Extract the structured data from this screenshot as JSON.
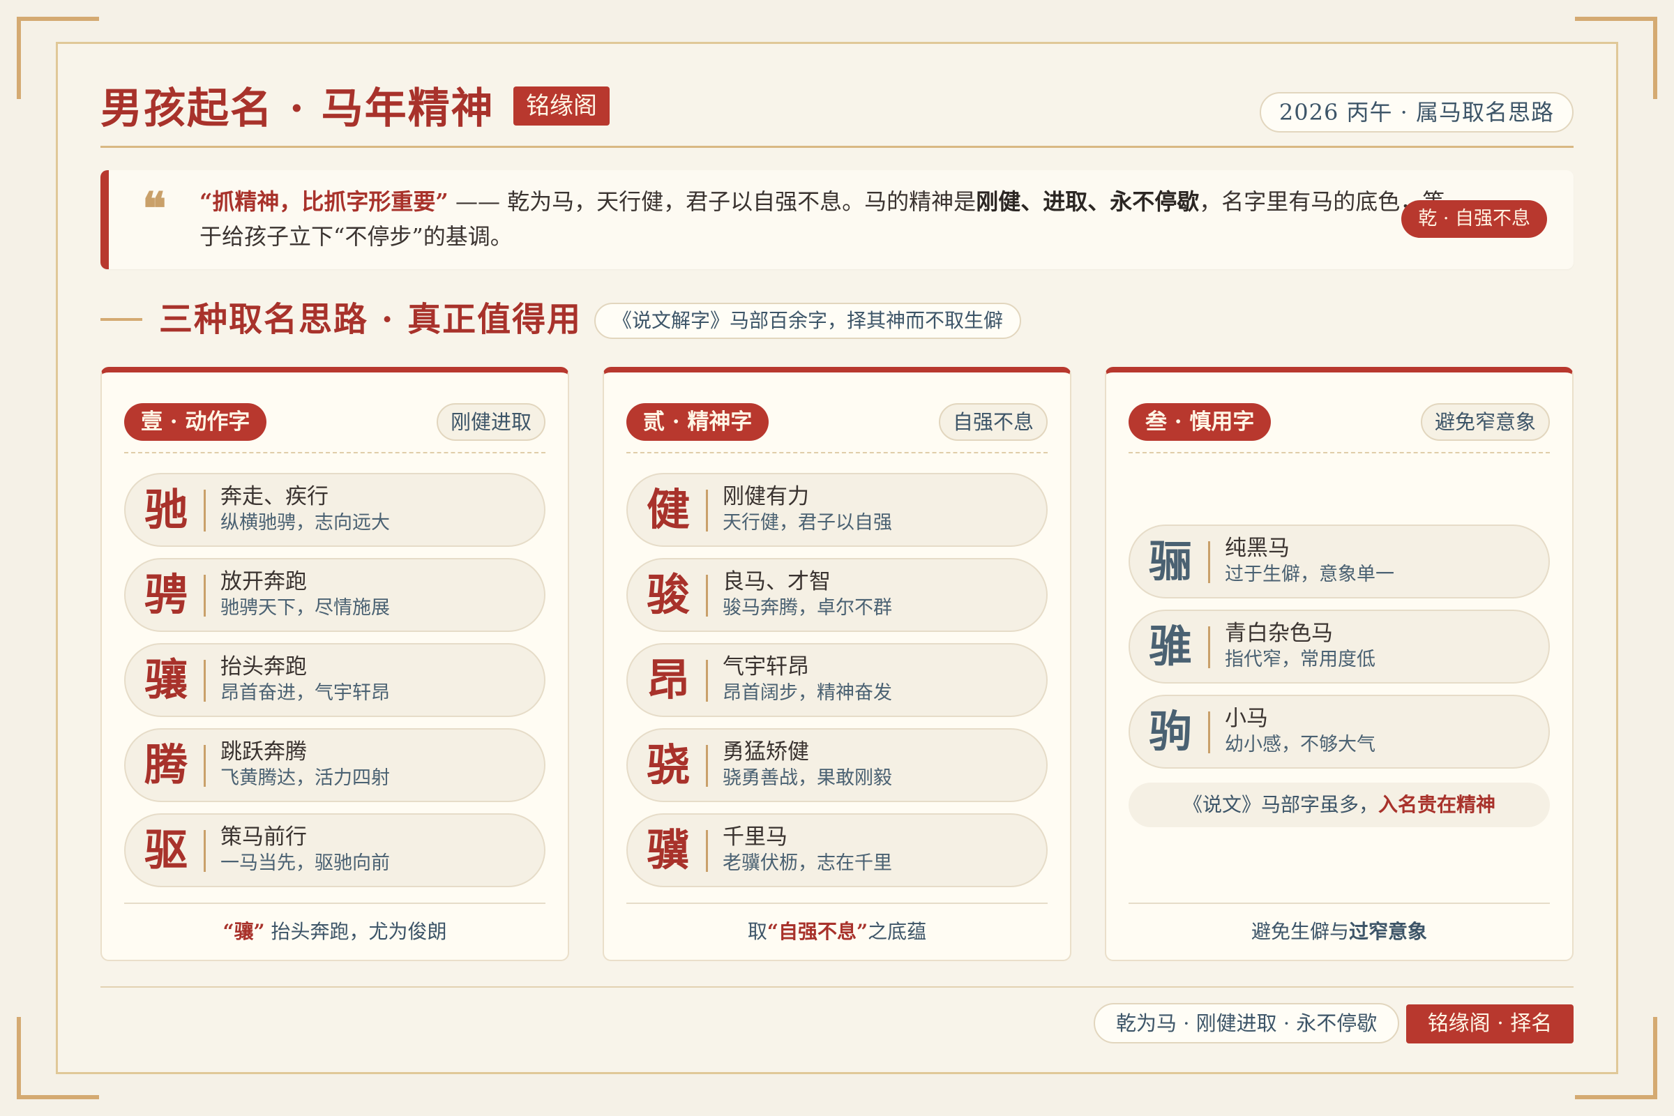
{
  "header": {
    "title": "男孩起名 · 马年精神",
    "brand_tag": "铭缘阁",
    "year_pill": "2026 丙午 · 属马取名思路"
  },
  "quote": {
    "mark": "❝",
    "lead": "“抓精神，比抓字形重要”",
    "text_part1": " —— 乾为马，天行健，君子以自强不息。马的精神是",
    "strong": "刚健、进取、永不停歇",
    "text_part2": "，名字里有马的底色，等于给孩子立下“不停步”的基调。",
    "badge": "乾 · 自强不息"
  },
  "section": {
    "title": "三种取名思路 · 真正值得用",
    "pill": "《说文解字》马部百余字，择其神而不取生僻"
  },
  "cards": [
    {
      "tag": "壹 · 动作字",
      "note": "刚健进取",
      "items": [
        {
          "char": "驰",
          "meaning": "奔走、疾行",
          "desc": "纵横驰骋，志向远大"
        },
        {
          "char": "骋",
          "meaning": "放开奔跑",
          "desc": "驰骋天下，尽情施展"
        },
        {
          "char": "骧",
          "meaning": "抬头奔跑",
          "desc": "昂首奋进，气宇轩昂"
        },
        {
          "char": "腾",
          "meaning": "跳跃奔腾",
          "desc": "飞黄腾达，活力四射"
        },
        {
          "char": "驱",
          "meaning": "策马前行",
          "desc": "一马当先，驱驰向前"
        }
      ],
      "footer_em": "“骧”",
      "footer_text": " 抬头奔跑，尤为俊朗"
    },
    {
      "tag": "贰 · 精神字",
      "note": "自强不息",
      "items": [
        {
          "char": "健",
          "meaning": "刚健有力",
          "desc": "天行健，君子以自强"
        },
        {
          "char": "骏",
          "meaning": "良马、才智",
          "desc": "骏马奔腾，卓尔不群"
        },
        {
          "char": "昂",
          "meaning": "气宇轩昂",
          "desc": "昂首阔步，精神奋发"
        },
        {
          "char": "骁",
          "meaning": "勇猛矫健",
          "desc": "骁勇善战，果敢刚毅"
        },
        {
          "char": "骥",
          "meaning": "千里马",
          "desc": "老骥伏枥，志在千里"
        }
      ],
      "footer_pre": "取",
      "footer_em": "“自强不息”",
      "footer_post": "之底蕴"
    },
    {
      "tag": "叁 · 慎用字",
      "note": "避免窄意象",
      "items": [
        {
          "char": "骊",
          "meaning": "纯黑马",
          "desc": "过于生僻，意象单一"
        },
        {
          "char": "骓",
          "meaning": "青白杂色马",
          "desc": "指代窄，常用度低"
        },
        {
          "char": "驹",
          "meaning": "小马",
          "desc": "幼小感，不够大气"
        }
      ],
      "note_pill_text": "《说文》马部字虽多，",
      "note_pill_em": "入名贵在精神",
      "footer_pre": "避免生僻与",
      "footer_em": "过窄意象"
    }
  ],
  "footer": {
    "pill": "乾为马 · 刚健进取 · 永不停歇",
    "tag": "铭缘阁 · 择名"
  }
}
